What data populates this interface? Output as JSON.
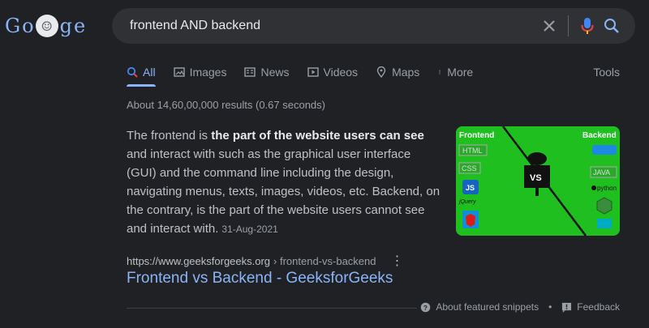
{
  "search": {
    "query": "frontend AND backend"
  },
  "tabs": [
    {
      "label": "All",
      "icon": "search-icon"
    },
    {
      "label": "Images",
      "icon": "image-icon"
    },
    {
      "label": "News",
      "icon": "news-icon"
    },
    {
      "label": "Videos",
      "icon": "video-icon"
    },
    {
      "label": "Maps",
      "icon": "map-pin-icon"
    },
    {
      "label": "More",
      "icon": "dots-vertical-icon"
    }
  ],
  "tools_label": "Tools",
  "stats": "About 14,60,00,000 results (0.67 seconds)",
  "snippet": {
    "intro": "The frontend is ",
    "bold": "the part of the website users can see",
    "rest": " and interact with such as the graphical user interface (GUI) and the command line including the design, navigating menus, texts, images, videos, etc. Backend, on the contrary, is the part of the website users cannot see and interact with.",
    "date": "31-Aug-2021"
  },
  "thumbnail": {
    "left_label": "Frontend",
    "right_label": "Backend",
    "center_label": "VS",
    "left_items": [
      "HTML",
      "CSS",
      "JS",
      "jQuery"
    ],
    "right_items": [
      "JAVA",
      "python"
    ]
  },
  "result": {
    "url": "https://www.geeksforgeeks.org",
    "path": "› frontend-vs-backend",
    "title": "Frontend vs Backend - GeeksforGeeks"
  },
  "footer": {
    "about": "About featured snippets",
    "separator": "•",
    "feedback": "Feedback"
  },
  "colors": {
    "link": "#8ab4f8",
    "bg": "#202124",
    "mic_blue": "#4285f4",
    "mic_red": "#ea4335"
  }
}
